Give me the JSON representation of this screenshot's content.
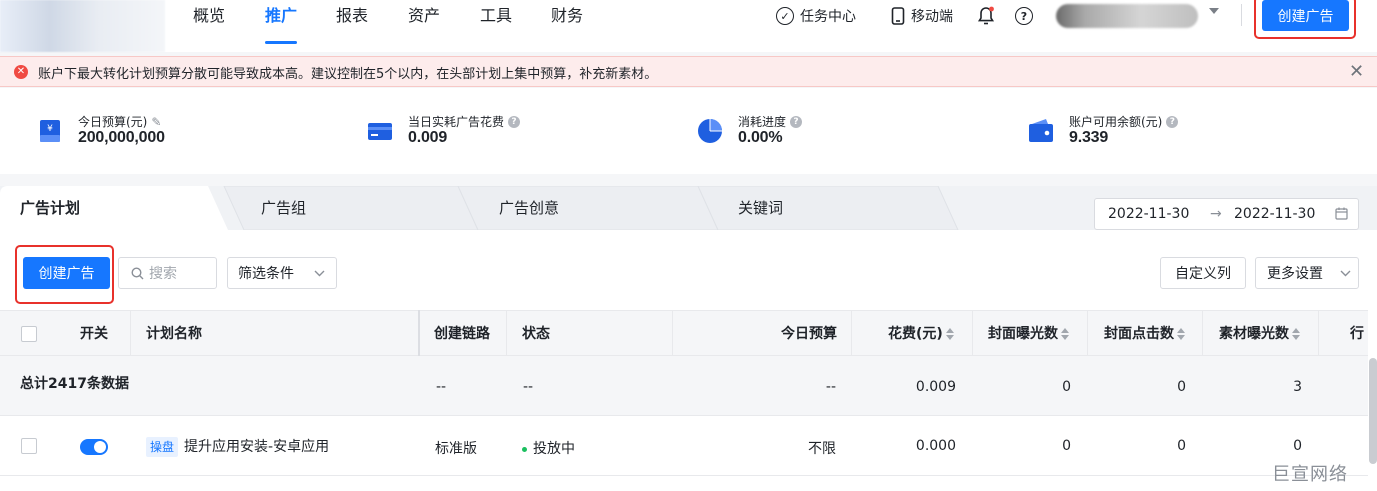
{
  "nav": {
    "items": [
      "概览",
      "推广",
      "报表",
      "资产",
      "工具",
      "财务"
    ],
    "active": "推广",
    "task_center": "任务中心",
    "mobile": "移动端",
    "create_ad": "创建广告"
  },
  "alert": {
    "text": "账户下最大转化计划预算分散可能导致成本高。建议控制在5个以内，在头部计划上集中预算，补充新素材。"
  },
  "stats": [
    {
      "label": "今日预算(元)",
      "value": "200,000,000",
      "icon": "wallet-icon",
      "color": "#1677ff"
    },
    {
      "label": "当日实耗广告花费",
      "value": "0.009",
      "icon": "card-icon",
      "color": "#1677ff"
    },
    {
      "label": "消耗进度",
      "value": "0.00%",
      "icon": "pie-icon",
      "color": "#1677ff"
    },
    {
      "label": "账户可用余额(元)",
      "value": "9.339",
      "icon": "purse-icon",
      "color": "#1677ff"
    }
  ],
  "tabs": [
    "广告计划",
    "广告组",
    "广告创意",
    "关键词"
  ],
  "date_range": {
    "start": "2022-11-30",
    "end": "2022-11-30"
  },
  "toolbar": {
    "create_ad": "创建广告",
    "search_placeholder": "搜索",
    "filter": "筛选条件",
    "custom_columns": "自定义列",
    "more_settings": "更多设置"
  },
  "table": {
    "columns": [
      "开关",
      "计划名称",
      "创建链路",
      "状态",
      "今日预算",
      "花费(元)",
      "封面曝光数",
      "封面点击数",
      "素材曝光数",
      "行"
    ],
    "summary": {
      "label": "总计2417条数据",
      "chain": "--",
      "status": "--",
      "budget": "--",
      "cost": "0.009",
      "cover_impressions": "0",
      "cover_clicks": "0",
      "material_impressions": "3"
    },
    "rows": [
      {
        "tag": "操盘",
        "name": "提升应用安装-安卓应用",
        "chain": "标准版",
        "status": "投放中",
        "budget": "不限",
        "cost": "0.000",
        "cover_impressions": "0",
        "cover_clicks": "0",
        "material_impressions": "0"
      }
    ]
  },
  "brand": "巨宣网络"
}
